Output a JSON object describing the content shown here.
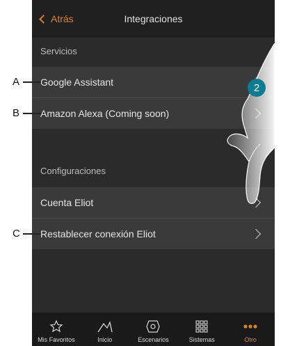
{
  "header": {
    "back_label": "Atrás",
    "title": "Integraciones"
  },
  "sections": {
    "services_title": "Servicios",
    "config_title": "Configuraciones"
  },
  "services": [
    {
      "label": "Google Assistant"
    },
    {
      "label": "Amazon Alexa (Coming soon)"
    }
  ],
  "configs": [
    {
      "label": "Cuenta Eliot"
    },
    {
      "label": "Restablecer conexión Eliot"
    }
  ],
  "tabs": [
    {
      "label": "Mis Favoritos",
      "icon": "star-icon"
    },
    {
      "label": "Inicio",
      "icon": "home-icon"
    },
    {
      "label": "Escenarios",
      "icon": "scenario-icon"
    },
    {
      "label": "Sistemas",
      "icon": "grid-icon"
    },
    {
      "label": "Otro",
      "icon": "more-icon"
    }
  ],
  "callouts": {
    "a": "A",
    "b": "B",
    "c": "C",
    "step": "2"
  },
  "colors": {
    "accent": "#d9802a",
    "badge": "#0d7c93"
  }
}
